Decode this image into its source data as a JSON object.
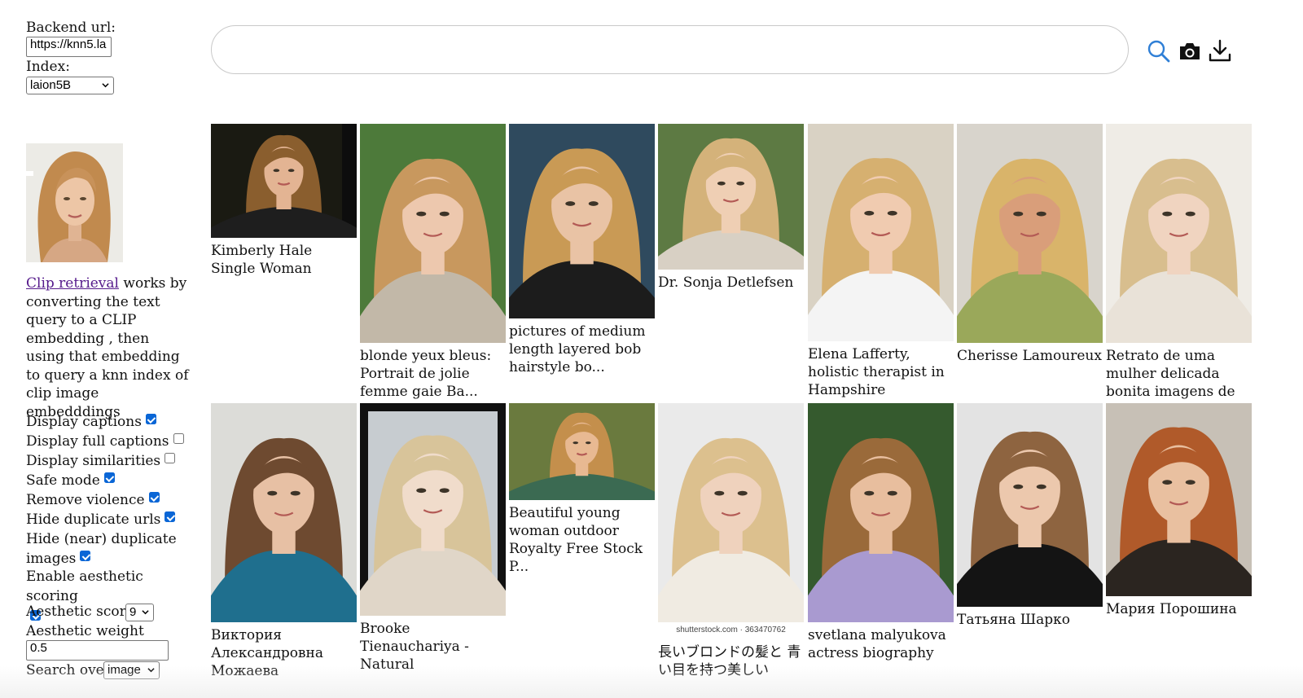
{
  "sidebar": {
    "backend_label": "Backend url:",
    "backend_value": "https://knn5.la",
    "index_label": "Index:",
    "index_value": "laion5B",
    "description_link": "Clip retrieval",
    "description_text": " works by converting the text query to a CLIP embedding , then using that embedding to query a knn index of clip image embedddings",
    "options": [
      {
        "label": "Display captions",
        "checked": true
      },
      {
        "label": "Display full captions",
        "checked": false
      },
      {
        "label": "Display similarities",
        "checked": false
      },
      {
        "label": "Safe mode",
        "checked": true
      },
      {
        "label": "Remove violence",
        "checked": true
      },
      {
        "label": "Hide duplicate urls",
        "checked": true
      },
      {
        "label": "Hide (near) duplicate images",
        "checked": true
      },
      {
        "label": "Enable aesthetic scoring",
        "checked": true
      }
    ],
    "aesthetic_score_label": "Aesthetic score",
    "aesthetic_score_value": "9",
    "aesthetic_weight_label": "Aesthetic weight",
    "aesthetic_weight_value": "0.5",
    "search_over_label": "Search over",
    "search_over_value": "image"
  },
  "search": {
    "query": "",
    "icons": [
      "search-icon",
      "camera-icon",
      "download-icon"
    ]
  },
  "colors": {
    "link": "#551a8b",
    "checkbox": "#0a66d6",
    "search_icon": "#2f7fd6"
  },
  "results": [
    {
      "caption": "Kimberly Hale Single Woman",
      "bg": "#1a1a12",
      "hair": "#8a5e2e",
      "skin": "#e3b493",
      "cloth": "#1e1e1e"
    },
    {
      "caption": "blonde yeux bleus: Portrait de jolie femme gaie Ba...",
      "bg": "#4d7a3a",
      "hair": "#c8985e",
      "skin": "#edc8ae",
      "cloth": "#c2b8a8"
    },
    {
      "caption": "pictures of medium length layered bob hairstyle bo...",
      "bg": "#2f4a5e",
      "hair": "#c99a55",
      "skin": "#e9c3a5",
      "cloth": "#1c1c1c"
    },
    {
      "caption": "Dr. Sonja Detlefsen",
      "bg": "#5d7a43",
      "hair": "#d4b27a",
      "skin": "#efcfb4",
      "cloth": "#d8d0c4"
    },
    {
      "caption": "Elena Lafferty, holistic therapist in Hampshire",
      "bg": "#d9d2c4",
      "hair": "#d6b070",
      "skin": "#f0cbb0",
      "cloth": "#f4f4f4"
    },
    {
      "caption": "Cherisse Lamoureux",
      "bg": "#d8d4cc",
      "hair": "#d9b46a",
      "skin": "#d99e7a",
      "cloth": "#9aa85a"
    },
    {
      "caption": "Retrato de uma mulher delicada bonita imagens de s...",
      "bg": "#efece6",
      "hair": "#d8be8e",
      "skin": "#f0d4c0",
      "cloth": "#e9e2d8"
    },
    {
      "caption": "Виктория Александровна Можаева",
      "bg": "#dcdcd8",
      "hair": "#6e4a30",
      "skin": "#e7c0a4",
      "cloth": "#1f6f8e"
    },
    {
      "caption": "Brooke Tienauchariya - Natural",
      "bg": "#c7ccd0",
      "hair": "#d8c49a",
      "skin": "#f0dccb",
      "cloth": "#e0d6c8"
    },
    {
      "caption": "Beautiful young woman outdoor Royalty Free Stock P...",
      "bg": "#6a7a3e",
      "hair": "#c48f4c",
      "skin": "#e8b992",
      "cloth": "#3b6a52"
    },
    {
      "caption": "長いブロンドの髪と 青い目を持つ美しい",
      "bg": "#eaeaea",
      "hair": "#dcc08e",
      "skin": "#efd2bd",
      "cloth": "#f0ebe2"
    },
    {
      "caption": "svetlana malyukova actress biography",
      "bg": "#355a2e",
      "hair": "#9a6a3a",
      "skin": "#e8be9e",
      "cloth": "#a99ad0"
    },
    {
      "caption": "Татьяна Шарко",
      "bg": "#e3e3e3",
      "hair": "#8e6440",
      "skin": "#ecc8ad",
      "cloth": "#141414"
    },
    {
      "caption": "Мария Порошина",
      "bg": "#c7c0b6",
      "hair": "#b05a2a",
      "skin": "#e9c0a0",
      "cloth": "#2b2520"
    }
  ],
  "watermark_text": "shutterstock.com · 363470762"
}
